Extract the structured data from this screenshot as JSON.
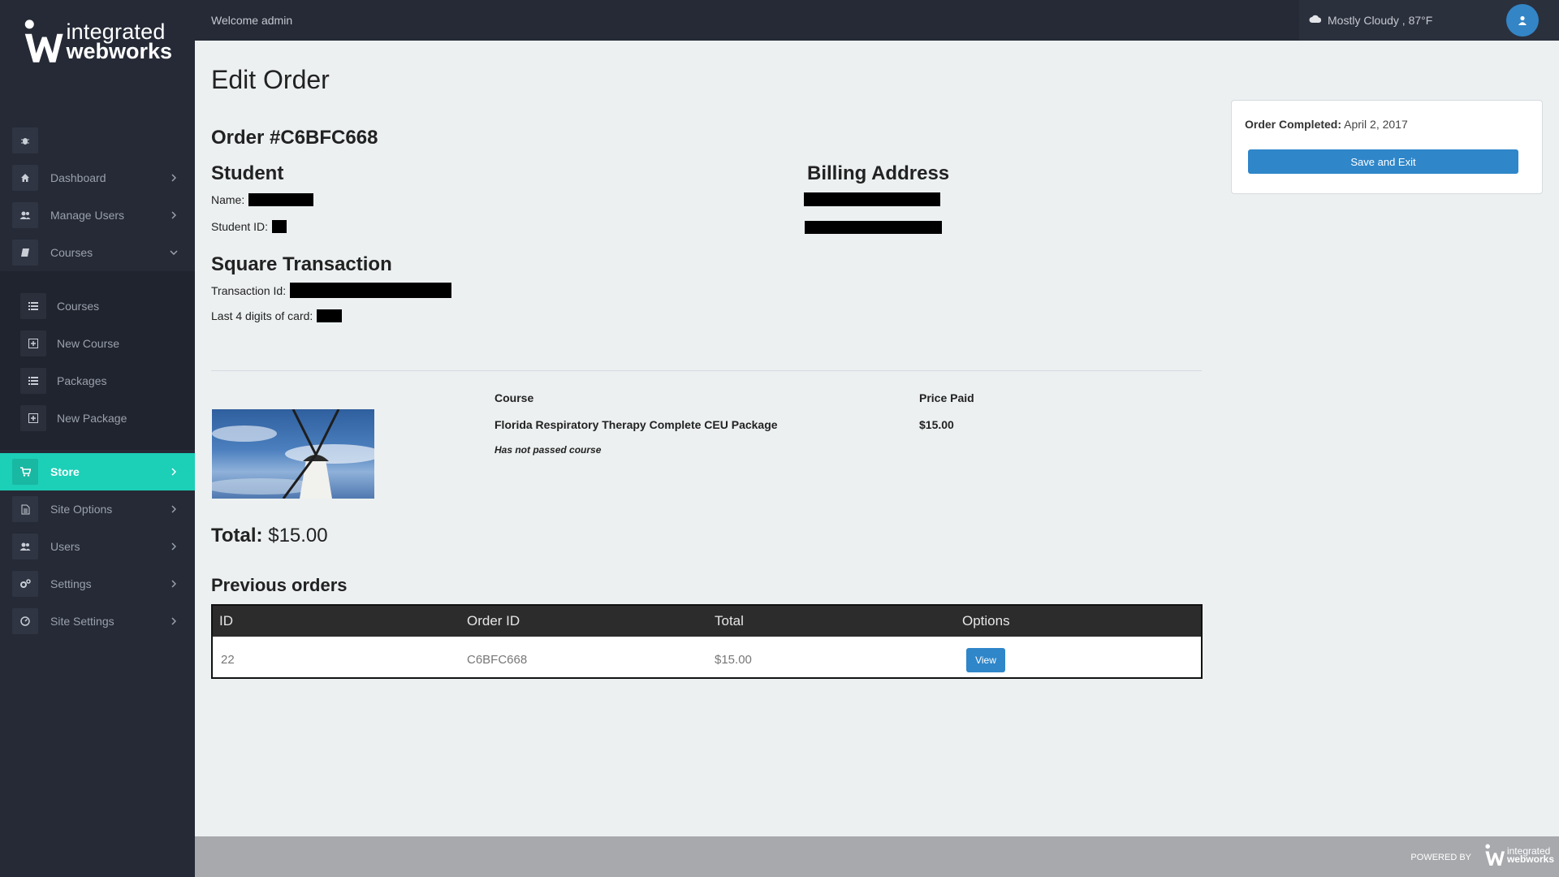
{
  "brand": {
    "logo_line1": "integrated",
    "logo_line2": "webworks"
  },
  "topbar": {
    "welcome": "Welcome admin",
    "weather": "Mostly Cloudy , 87°F",
    "weather_icon": "cloud-icon",
    "avatar_icon": "user-icon"
  },
  "sidebar": {
    "items": [
      {
        "label": "",
        "icon": "bug-icon"
      },
      {
        "label": "Dashboard",
        "icon": "home-icon"
      },
      {
        "label": "Manage Users",
        "icon": "users-icon"
      },
      {
        "label": "Courses",
        "icon": "book-icon"
      },
      {
        "label": "Store",
        "icon": "cart-icon",
        "active": true
      },
      {
        "label": "Site Options",
        "icon": "document-icon"
      },
      {
        "label": "Users",
        "icon": "users-icon"
      },
      {
        "label": "Settings",
        "icon": "cogs-icon"
      },
      {
        "label": "Site Settings",
        "icon": "dashboard-icon"
      }
    ],
    "courses_sub": [
      {
        "label": "Courses",
        "icon": "list-icon"
      },
      {
        "label": "New Course",
        "icon": "plus-square-icon"
      },
      {
        "label": "Packages",
        "icon": "list-icon"
      },
      {
        "label": "New Package",
        "icon": "plus-square-icon"
      }
    ]
  },
  "main": {
    "title": "Edit Order",
    "order_number": "Order #C6BFC668",
    "student_heading": "Student",
    "name_label": "Name:",
    "student_id_label": "Student ID:",
    "billing_heading": "Billing Address",
    "square_heading": "Square Transaction",
    "transaction_label": "Transaction Id:",
    "card_label": "Last 4 digits of card:",
    "course_col": "Course",
    "price_col": "Price Paid",
    "course_name": "Florida Respiratory Therapy Complete CEU Package",
    "price": "$15.00",
    "course_status": "Has not passed course",
    "total_label": "Total:",
    "total_value": "$15.00",
    "previous_heading": "Previous orders",
    "table": {
      "headers": [
        "ID",
        "Order ID",
        "Total",
        "Options"
      ],
      "rows": [
        {
          "id": "22",
          "order_id": "C6BFC668",
          "total": "$15.00",
          "action": "View"
        }
      ]
    }
  },
  "panel": {
    "completed_label": "Order Completed:",
    "completed_date": "April 2, 2017",
    "save_button": "Save and Exit"
  },
  "footer": {
    "powered_by": "POWERED BY",
    "logo_line1": "integrated",
    "logo_line2": "webworks"
  },
  "colors": {
    "sidebar_bg": "#252a36",
    "active_teal": "#1ccfb7",
    "primary_blue": "#2f86c9",
    "content_bg": "#ecf0f1"
  }
}
